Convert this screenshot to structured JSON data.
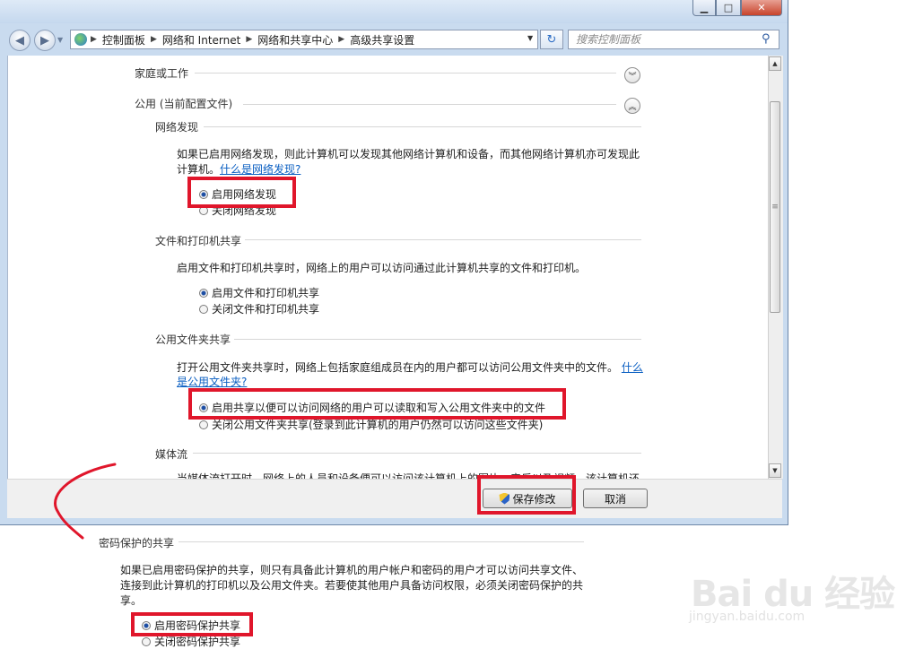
{
  "window": {
    "min_glyph": "▁",
    "max_glyph": "□",
    "close_glyph": "✕"
  },
  "nav": {
    "back_glyph": "◀",
    "forward_glyph": "▶",
    "history_glyph": "▼",
    "breadcrumbs": [
      "控制面板",
      "网络和 Internet",
      "网络和共享中心",
      "高级共享设置"
    ],
    "crumb_sep": "▶",
    "dropdown_glyph": "▼",
    "refresh_glyph": "↻",
    "search_placeholder": "搜索控制面板",
    "search_glyph": "⚲"
  },
  "profiles": {
    "home_work": "家庭或工作",
    "public": "公用 (当前配置文件)",
    "chev_down": "︾",
    "chev_up": "︽"
  },
  "network_discovery": {
    "title": "网络发现",
    "desc1": "如果已启用网络发现，则此计算机可以发现其他网络计算机和设备，而其他网络计算机亦可发现此",
    "desc2_prefix": "计算机。",
    "link": "什么是网络发现?",
    "opt_on": "启用网络发现",
    "opt_off": "关闭网络发现"
  },
  "file_printer": {
    "title": "文件和打印机共享",
    "desc": "启用文件和打印机共享时，网络上的用户可以访问通过此计算机共享的文件和打印机。",
    "opt_on": "启用文件和打印机共享",
    "opt_off": "关闭文件和打印机共享"
  },
  "public_folder": {
    "title": "公用文件夹共享",
    "desc1": "打开公用文件夹共享时，网络上包括家庭组成员在内的用户都可以访问公用文件夹中的文件。",
    "link1": "什么",
    "link2": "是公用文件夹?",
    "opt_on": "启用共享以便可以访问网络的用户可以读取和写入公用文件夹中的文件",
    "opt_off": "关闭公用文件夹共享(登录到此计算机的用户仍然可以访问这些文件夹)"
  },
  "media": {
    "title": "媒体流",
    "desc": "当媒体流打开时，网络上的人员和设备便可以访问该计算机上的图片、音乐以及视频。该计算机还"
  },
  "footer": {
    "save": "保存修改",
    "cancel": "取消"
  },
  "password": {
    "title": "密码保护的共享",
    "desc1": "如果已启用密码保护的共享，则只有具备此计算机的用户帐户和密码的用户才可以访问共享文件、",
    "desc2": "连接到此计算机的打印机以及公用文件夹。若要使其他用户具备访问权限，必须关闭密码保护的共",
    "desc3": "享。",
    "opt_on": "启用密码保护共享",
    "opt_off": "关闭密码保护共享"
  },
  "scroll": {
    "up": "▲",
    "down": "▼",
    "grip": "≡"
  },
  "watermark": {
    "brand": "Bai du 经验",
    "url": "jingyan.baidu.com"
  },
  "colors": {
    "highlight": "#e0162b",
    "link": "#0b5fc2"
  }
}
